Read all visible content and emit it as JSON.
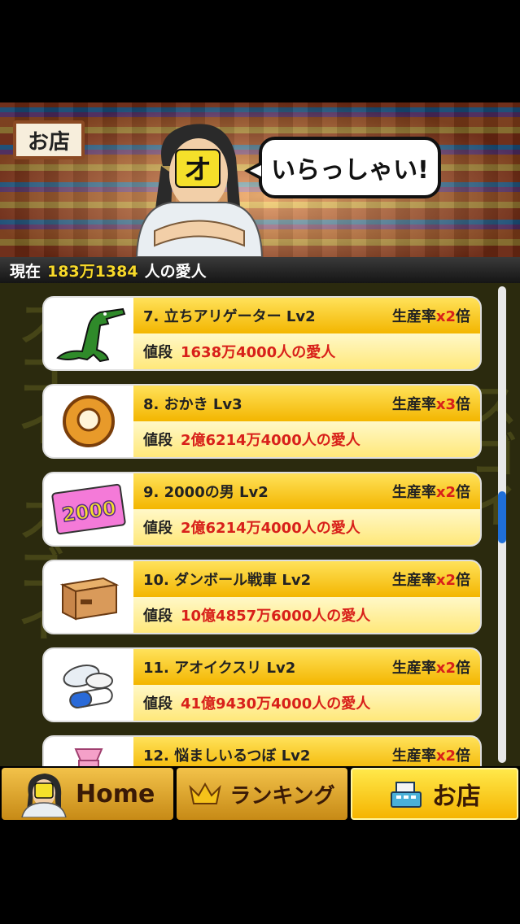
{
  "header": {
    "shop_sign": "お店",
    "shopkeeper_mark": "オ",
    "greeting": "いらっしゃい!"
  },
  "status": {
    "prefix": "現在",
    "count": "183万1384",
    "suffix": "人の愛人"
  },
  "background_text": [
    "スゴイ",
    "スゴイ",
    "スゴイ"
  ],
  "items": [
    {
      "name": "7. 立ちアリゲーター Lv2",
      "rate_label": "生産率",
      "multiplier": "x2",
      "rate_suffix": "倍",
      "price_label": "値段",
      "price": "1638万4000人の愛人",
      "icon": "alligator-icon"
    },
    {
      "name": "8. おかき Lv3",
      "rate_label": "生産率",
      "multiplier": "x3",
      "rate_suffix": "倍",
      "price_label": "値段",
      "price": "2億6214万4000人の愛人",
      "icon": "rice-cracker-icon"
    },
    {
      "name": "9. 2000の男 Lv2",
      "rate_label": "生産率",
      "multiplier": "x2",
      "rate_suffix": "倍",
      "price_label": "値段",
      "price": "2億6214万4000人の愛人",
      "icon": "ticket-2000-icon",
      "icon_text": "2000"
    },
    {
      "name": "10. ダンボール戦車 Lv2",
      "rate_label": "生産率",
      "multiplier": "x2",
      "rate_suffix": "倍",
      "price_label": "値段",
      "price": "10億4857万6000人の愛人",
      "icon": "cardboard-box-icon"
    },
    {
      "name": "11. アオイクスリ Lv2",
      "rate_label": "生産率",
      "multiplier": "x2",
      "rate_suffix": "倍",
      "price_label": "値段",
      "price": "41億9430万4000人の愛人",
      "icon": "pills-icon"
    },
    {
      "name": "12. 悩ましいるつぼ Lv2",
      "rate_label": "生産率",
      "multiplier": "x2",
      "rate_suffix": "倍",
      "price_label": "値段",
      "price": "",
      "icon": "crucible-icon"
    }
  ],
  "nav": {
    "home": "Home",
    "ranking": "ランキング",
    "shop": "お店"
  },
  "colors": {
    "accent_red": "#d8201a",
    "gold": "#f3b600",
    "scroll_thumb": "#1f6fd8"
  }
}
